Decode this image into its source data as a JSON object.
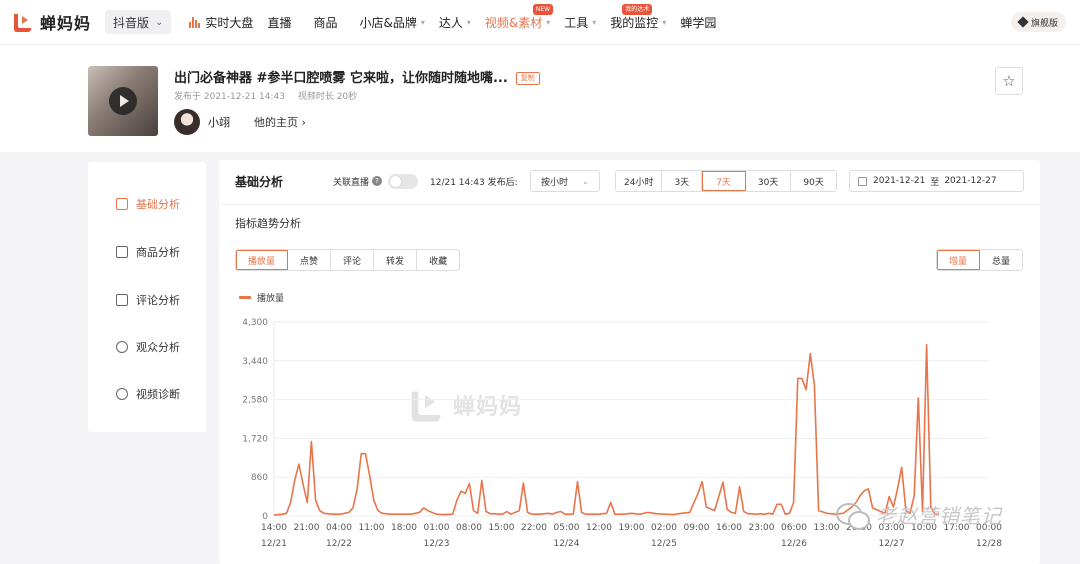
{
  "app": {
    "name": "蝉妈妈",
    "brand_color": "#e8744a"
  },
  "platform": {
    "label": "抖音版"
  },
  "nav": {
    "items": [
      {
        "label": "实时大盘",
        "icon": "bars-icon"
      },
      {
        "label": "直播"
      },
      {
        "label": "商品"
      },
      {
        "label": "小店&品牌"
      },
      {
        "label": "达人"
      },
      {
        "label": "视频&素材",
        "badge": "NEW"
      },
      {
        "label": "工具"
      },
      {
        "label": "我的监控",
        "badge": "我的达术"
      },
      {
        "label": "蝉学园"
      }
    ],
    "flagship": "旗舰版"
  },
  "video": {
    "title": "出门必备神器 #参半口腔喷雾 它来啦，让你随时随地嘴...",
    "copy_label": "复制",
    "publish_time": "发布于 2021-12-21 14:43",
    "duration": "视频时长 20秒",
    "author": "小翊",
    "homepage_link": "他的主页"
  },
  "sidebar": {
    "items": [
      {
        "label": "基础分析"
      },
      {
        "label": "商品分析"
      },
      {
        "label": "评论分析"
      },
      {
        "label": "观众分析"
      },
      {
        "label": "视频诊断"
      }
    ]
  },
  "panel": {
    "title": "基础分析",
    "link_live": "关联直播",
    "publish_after": "12/21 14:43 发布后:",
    "granularity": "按小时",
    "ranges": [
      "24小时",
      "3天",
      "7天",
      "30天",
      "90天"
    ],
    "date_from": "2021-12-21",
    "date_to_sep": "至",
    "date_to": "2021-12-27",
    "subtitle": "指标趋势分析",
    "metric_tabs": [
      "播放量",
      "点赞",
      "评论",
      "转发",
      "收藏"
    ],
    "mode_tabs": [
      "增量",
      "总量"
    ],
    "watermark": "蝉妈妈"
  },
  "wechat_watermark": "老赵营销笔记",
  "chart_data": {
    "type": "line",
    "series": [
      {
        "name": "播放量",
        "color": "#e8744a"
      }
    ],
    "ylim": [
      0,
      4300
    ],
    "yticks": [
      0,
      860,
      1720,
      2580,
      3440,
      4300
    ],
    "ytick_labels": [
      "0",
      "860",
      "1,720",
      "2,580",
      "3,440",
      "4,300"
    ],
    "xlim_hours": [
      0,
      172
    ],
    "xticks": [
      {
        "label": "14:00",
        "date": "12/21"
      },
      {
        "label": "21:00"
      },
      {
        "label": "04:00",
        "date": "12/22"
      },
      {
        "label": "11:00"
      },
      {
        "label": "18:00"
      },
      {
        "label": "01:00",
        "date": "12/23"
      },
      {
        "label": "08:00"
      },
      {
        "label": "15:00"
      },
      {
        "label": "22:00"
      },
      {
        "label": "05:00",
        "date": "12/24"
      },
      {
        "label": "12:00"
      },
      {
        "label": "19:00"
      },
      {
        "label": "02:00",
        "date": "12/25"
      },
      {
        "label": "09:00"
      },
      {
        "label": "16:00"
      },
      {
        "label": "23:00"
      },
      {
        "label": "06:00",
        "date": "12/26"
      },
      {
        "label": "13:00"
      },
      {
        "label": "20:00"
      },
      {
        "label": "03:00",
        "date": "12/27"
      },
      {
        "label": "10:00"
      },
      {
        "label": "17:00"
      },
      {
        "label": "00:00",
        "date": "12/28"
      }
    ],
    "points": [
      [
        0,
        20
      ],
      [
        2,
        40
      ],
      [
        3,
        60
      ],
      [
        4,
        300
      ],
      [
        5,
        800
      ],
      [
        6,
        1150
      ],
      [
        7,
        700
      ],
      [
        8,
        300
      ],
      [
        9,
        1650
      ],
      [
        10,
        350
      ],
      [
        11,
        120
      ],
      [
        12,
        60
      ],
      [
        14,
        40
      ],
      [
        16,
        40
      ],
      [
        18,
        80
      ],
      [
        19,
        180
      ],
      [
        20,
        600
      ],
      [
        21,
        1380
      ],
      [
        22,
        1380
      ],
      [
        23,
        900
      ],
      [
        24,
        350
      ],
      [
        25,
        120
      ],
      [
        26,
        60
      ],
      [
        28,
        40
      ],
      [
        30,
        40
      ],
      [
        33,
        40
      ],
      [
        35,
        80
      ],
      [
        36,
        180
      ],
      [
        37,
        120
      ],
      [
        39,
        40
      ],
      [
        41,
        30
      ],
      [
        43,
        40
      ],
      [
        44,
        350
      ],
      [
        45,
        550
      ],
      [
        46,
        500
      ],
      [
        47,
        720
      ],
      [
        48,
        120
      ],
      [
        49,
        60
      ],
      [
        50,
        790
      ],
      [
        51,
        100
      ],
      [
        52,
        50
      ],
      [
        55,
        40
      ],
      [
        56,
        100
      ],
      [
        57,
        40
      ],
      [
        59,
        120
      ],
      [
        60,
        730
      ],
      [
        61,
        80
      ],
      [
        62,
        40
      ],
      [
        64,
        40
      ],
      [
        66,
        60
      ],
      [
        67,
        40
      ],
      [
        68,
        80
      ],
      [
        69,
        100
      ],
      [
        70,
        40
      ],
      [
        72,
        40
      ],
      [
        73,
        760
      ],
      [
        74,
        80
      ],
      [
        75,
        40
      ],
      [
        78,
        40
      ],
      [
        80,
        60
      ],
      [
        81,
        300
      ],
      [
        82,
        40
      ],
      [
        84,
        40
      ],
      [
        86,
        60
      ],
      [
        88,
        40
      ],
      [
        90,
        80
      ],
      [
        92,
        50
      ],
      [
        94,
        40
      ],
      [
        96,
        30
      ],
      [
        98,
        60
      ],
      [
        100,
        80
      ],
      [
        102,
        500
      ],
      [
        103,
        760
      ],
      [
        104,
        200
      ],
      [
        106,
        120
      ],
      [
        108,
        750
      ],
      [
        109,
        150
      ],
      [
        110,
        80
      ],
      [
        111,
        60
      ],
      [
        112,
        650
      ],
      [
        113,
        100
      ],
      [
        114,
        50
      ],
      [
        116,
        40
      ],
      [
        117,
        50
      ],
      [
        118,
        40
      ],
      [
        119,
        60
      ],
      [
        120,
        40
      ],
      [
        121,
        260
      ],
      [
        122,
        260
      ],
      [
        123,
        40
      ],
      [
        124,
        60
      ],
      [
        125,
        300
      ],
      [
        126,
        3050
      ],
      [
        127,
        3050
      ],
      [
        128,
        2800
      ],
      [
        129,
        3600
      ],
      [
        130,
        2900
      ],
      [
        131,
        120
      ],
      [
        133,
        60
      ],
      [
        135,
        40
      ],
      [
        137,
        60
      ],
      [
        139,
        200
      ],
      [
        140,
        300
      ],
      [
        141,
        450
      ],
      [
        142,
        560
      ],
      [
        143,
        600
      ],
      [
        144,
        180
      ],
      [
        146,
        100
      ],
      [
        147,
        60
      ],
      [
        148,
        430
      ],
      [
        149,
        200
      ],
      [
        150,
        600
      ],
      [
        151,
        1080
      ],
      [
        152,
        120
      ],
      [
        153,
        60
      ],
      [
        154,
        450
      ],
      [
        155,
        2620
      ],
      [
        156,
        100
      ],
      [
        157,
        3800
      ],
      [
        158,
        200
      ],
      [
        159,
        40
      ],
      [
        160,
        30
      ]
    ]
  }
}
